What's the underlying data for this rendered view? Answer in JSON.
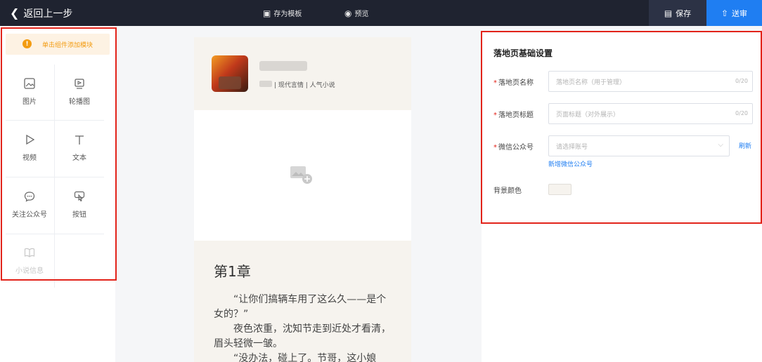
{
  "topbar": {
    "back_label": "返回上一步",
    "save_template_label": "存为模板",
    "preview_label": "预览",
    "save_label": "保存",
    "submit_label": "送审",
    "colors": {
      "bar": "#1f2330",
      "save_bg": "#2c3245",
      "submit_bg": "#1f7ef2"
    }
  },
  "left_panel": {
    "hint": "单击组件添加模块",
    "components": [
      {
        "label": "图片",
        "icon": "image-icon",
        "enabled": true
      },
      {
        "label": "轮播图",
        "icon": "carousel-icon",
        "enabled": true
      },
      {
        "label": "视频",
        "icon": "video-play-icon",
        "enabled": true
      },
      {
        "label": "文本",
        "icon": "text-icon",
        "enabled": true
      },
      {
        "label": "关注公众号",
        "icon": "chat-bubble-icon",
        "enabled": true
      },
      {
        "label": "按钮",
        "icon": "click-button-icon",
        "enabled": true
      },
      {
        "label": "小说信息",
        "icon": "book-icon",
        "enabled": false
      }
    ]
  },
  "preview": {
    "book_tags": "| 现代言情 | 人气小说",
    "chapter_title": "第1章",
    "paragraphs": [
      "“让你们搞辆车用了这么久——是个女的？”",
      "夜色浓重，沈知节走到近处才看清，眉头轻微一皱。",
      "“没办法，碰上了。节哥，这小娘"
    ]
  },
  "settings": {
    "title": "落地页基础设置",
    "name_label": "落地页名称",
    "name_placeholder": "落地页名称（用于管理）",
    "name_count": "0/20",
    "heading_label": "落地页标题",
    "heading_placeholder": "页面标题（对外展示）",
    "heading_count": "0/20",
    "wechat_label": "微信公众号",
    "wechat_placeholder": "请选择账号",
    "refresh_label": "刷新",
    "add_wechat_label": "新增微信公众号",
    "bg_color_label": "背景颜色",
    "bg_color_value": "#f6f3ee"
  }
}
